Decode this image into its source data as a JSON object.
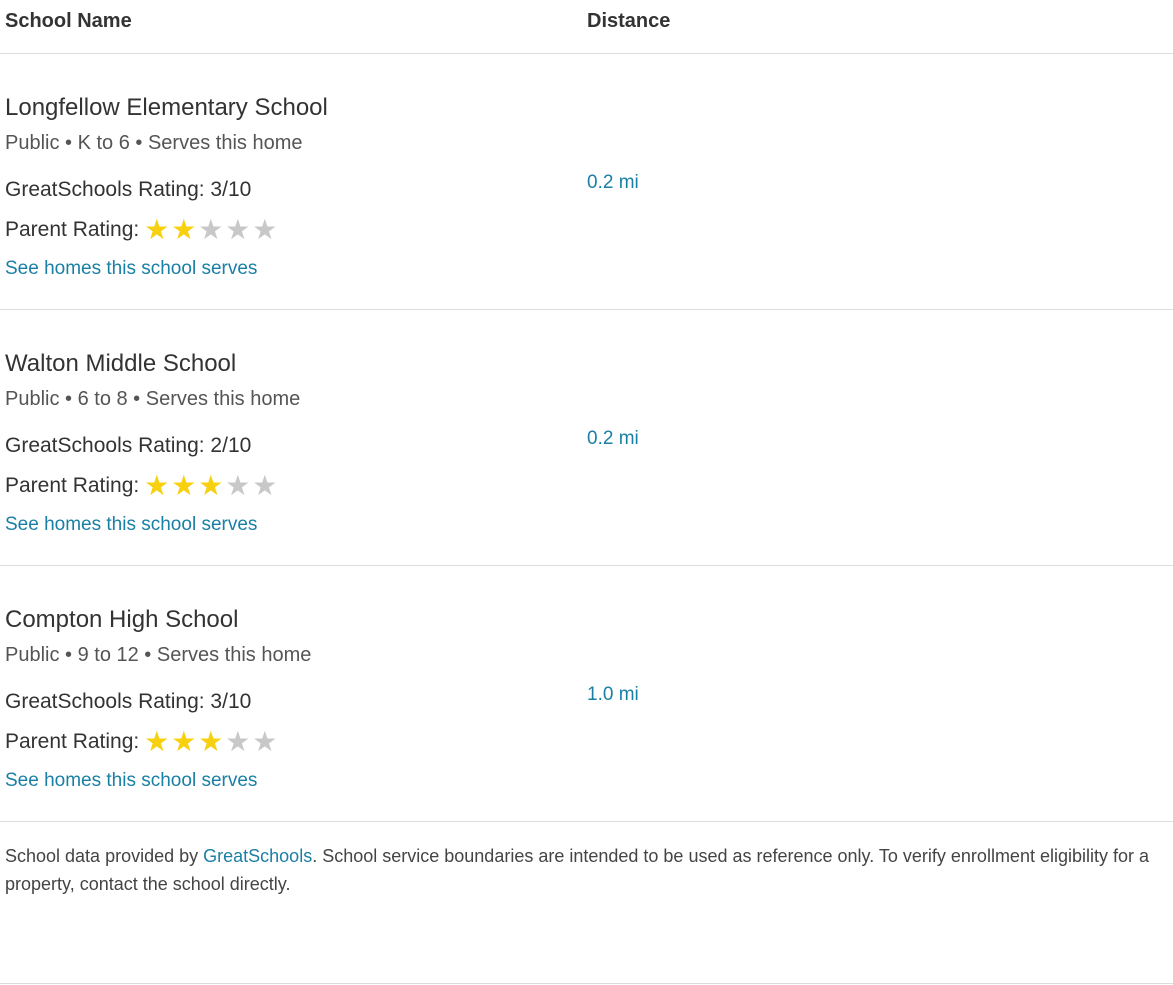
{
  "header": {
    "school_name_label": "School Name",
    "distance_label": "Distance"
  },
  "schools": [
    {
      "name": "Longfellow Elementary School",
      "meta": "Public • K to 6 • Serves this home",
      "gs_rating": "GreatSchools Rating: 3/10",
      "parent_label": "Parent Rating:",
      "parent_stars": 2,
      "link": "See homes this school serves",
      "distance": "0.2 mi"
    },
    {
      "name": "Walton Middle School",
      "meta": "Public • 6 to 8 • Serves this home",
      "gs_rating": "GreatSchools Rating: 2/10",
      "parent_label": "Parent Rating:",
      "parent_stars": 3,
      "link": "See homes this school serves",
      "distance": "0.2 mi"
    },
    {
      "name": "Compton High School",
      "meta": "Public • 9 to 12 • Serves this home",
      "gs_rating": "GreatSchools Rating: 3/10",
      "parent_label": "Parent Rating:",
      "parent_stars": 3,
      "link": "See homes this school serves",
      "distance": "1.0 mi"
    }
  ],
  "footnote": {
    "prefix": "School data provided by ",
    "link": "GreatSchools",
    "suffix": ". School service boundaries are intended to be used as reference only. To verify enrollment eligibility for a property, contact the school directly."
  },
  "colors": {
    "link": "#1a7fa5",
    "star_on": "#f7d00f",
    "star_off": "#c8c8c8",
    "divider": "#dcdcdc"
  },
  "icons": {
    "star": "star-icon"
  }
}
